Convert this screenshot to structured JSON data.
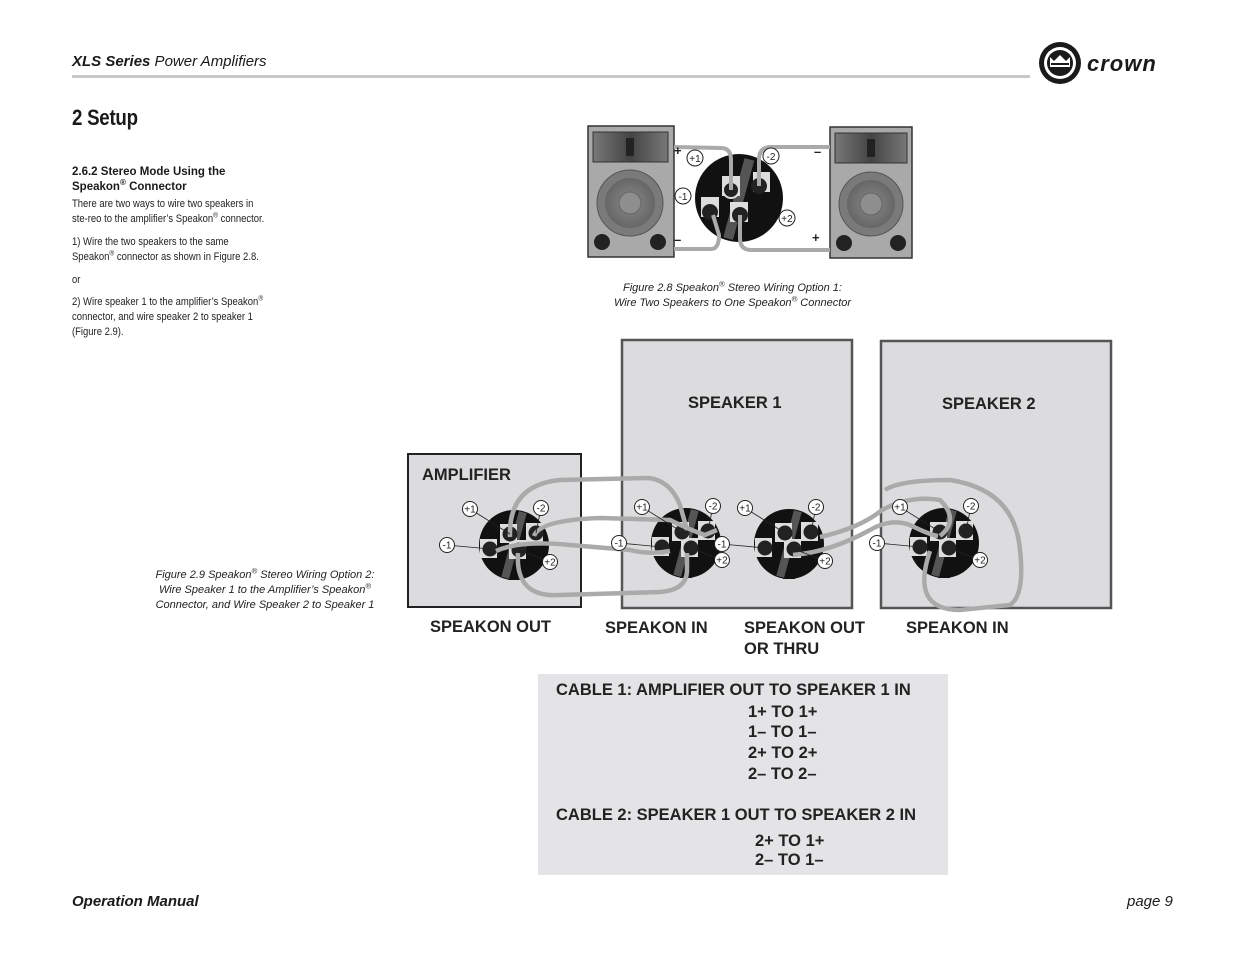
{
  "header": {
    "series_bold": "XLS Series",
    "series_rest": " Power Amplifiers",
    "logo_text": "crown",
    "logo_icon": "crown-logo-icon"
  },
  "section": {
    "title": "2 Setup",
    "subheading_line1": "2.6.2 Stereo Mode Using the",
    "subheading_line2": "Speakon",
    "subheading_line2_rest": " Connector",
    "reg": "®",
    "para1_a": "There are two ways to wire two speakers in ste-reo to the amplifier’s Speakon",
    "para1_b": " connector.",
    "para2_a": "1) Wire the two speakers to the same Speakon",
    "para2_b": " connector as shown in Figure 2.8.",
    "para3": "or",
    "para4_a": "2) Wire speaker 1 to the amplifier’s Speakon",
    "para4_b": " connector, and wire speaker 2 to speaker 1 (Figure 2.9)."
  },
  "figure_2_8": {
    "caption_line1_a": "Figure 2.8  Speakon",
    "caption_line1_b": " Stereo  Wiring Option 1:",
    "caption_line2_a": "Wire Two Speakers to One Speakon",
    "caption_line2_b": " Connector",
    "polarity": {
      "left_top": "+",
      "left_bottom": "–",
      "right_top": "–",
      "right_bottom": "+"
    },
    "pins": [
      "+1",
      "-1",
      "-2",
      "+2"
    ]
  },
  "figure_2_9": {
    "caption_line1_a": "Figure 2.9   Speakon",
    "caption_line1_b": " Stereo Wiring Option 2:",
    "caption_line2_a": "Wire Speaker 1 to the Amplifier’s Speakon",
    "caption_line3": "Connector, and Wire Speaker 2 to Speaker 1",
    "amplifier_label": "AMPLIFIER",
    "speaker1_label": "SPEAKER 1",
    "speaker2_label": "SPEAKER 2",
    "connector_labels": [
      "SPEAKON OUT",
      "SPEAKON IN",
      "SPEAKON OUT",
      "OR THRU",
      "SPEAKON IN"
    ],
    "pins": [
      "+1",
      "-1",
      "-2",
      "+2"
    ]
  },
  "cables": {
    "cable1_title": "CABLE 1: AMPLIFIER OUT TO SPEAKER 1 IN",
    "cable1_rows": [
      "1+  TO  1+",
      "1–  TO  1–",
      "2+  TO  2+",
      "2–  TO  2–"
    ],
    "cable2_title": "CABLE 2: SPEAKER 1 OUT TO SPEAKER 2 IN",
    "cable2_rows": [
      "2+  TO  1+",
      "2–  TO  1–"
    ]
  },
  "footer": {
    "left": "Operation Manual",
    "right": "page 9"
  }
}
